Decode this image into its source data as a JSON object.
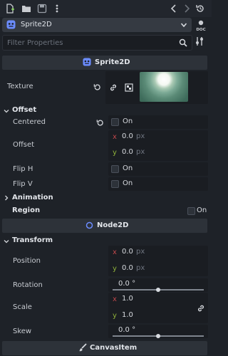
{
  "inspector": {
    "object_name": "Sprite2D",
    "filter_placeholder": "Filter Properties"
  },
  "class_headers": {
    "sprite2d": "Sprite2D",
    "node2d": "Node2D",
    "canvasitem": "CanvasItem"
  },
  "sprite2d": {
    "texture_label": "Texture",
    "offset_section": "Offset",
    "centered_label": "Centered",
    "centered_value": "On",
    "offset_label": "Offset",
    "offset_x_axis": "x",
    "offset_x": "0.0",
    "offset_x_unit": "px",
    "offset_y_axis": "y",
    "offset_y": "0.0",
    "offset_y_unit": "px",
    "fliph_label": "Flip H",
    "fliph_value": "On",
    "flipv_label": "Flip V",
    "flipv_value": "On",
    "animation_section": "Animation",
    "region_section": "Region",
    "region_value": "On"
  },
  "node2d": {
    "transform_section": "Transform",
    "position_label": "Position",
    "position_x_axis": "x",
    "position_x": "0.0",
    "position_x_unit": "px",
    "position_y_axis": "y",
    "position_y": "0.0",
    "position_y_unit": "px",
    "rotation_label": "Rotation",
    "rotation_value": "0.0 °",
    "rotation_slider_fraction": 0.5,
    "scale_label": "Scale",
    "scale_x_axis": "x",
    "scale_x": "1.0",
    "scale_y_axis": "y",
    "scale_y": "1.0",
    "skew_label": "Skew",
    "skew_value": "0.0 °",
    "skew_slider_fraction": 0.5
  },
  "colors": {
    "accent": "#6b8cff",
    "x_axis": "#c0474b",
    "y_axis": "#8fb23a"
  }
}
